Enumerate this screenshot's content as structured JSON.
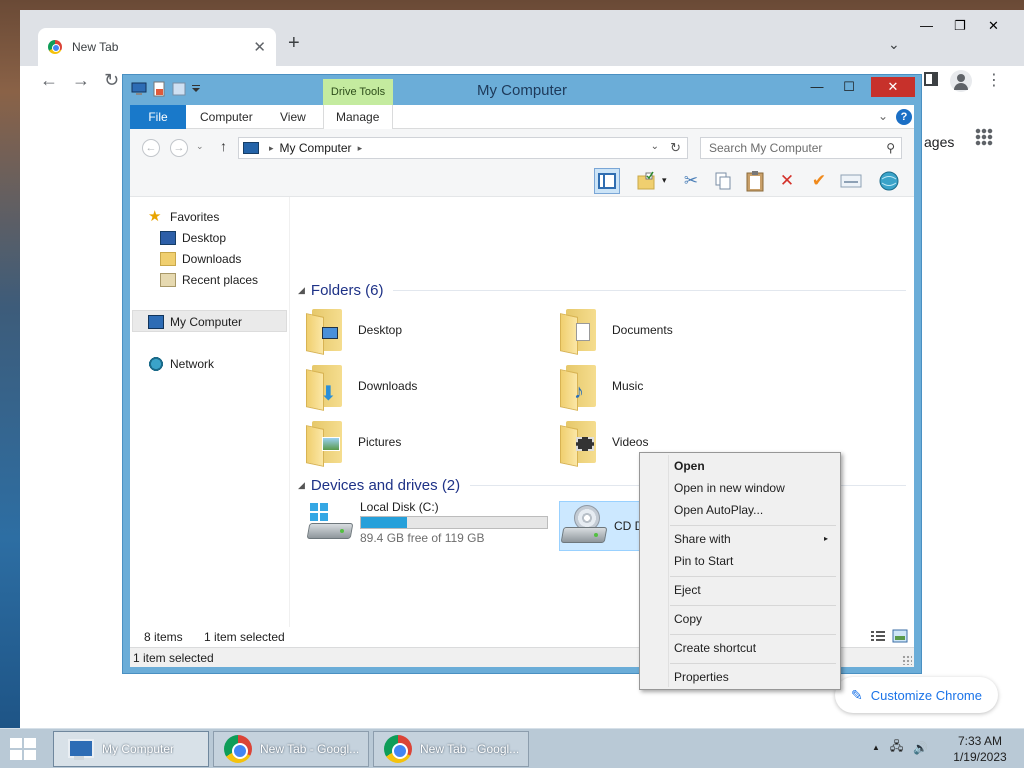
{
  "chrome": {
    "tab_title": "New Tab",
    "tab_close": "✕",
    "new_tab": "+",
    "tab_search": "⌄",
    "min": "—",
    "max": "❐",
    "close": "✕",
    "back": "←",
    "forward": "→",
    "reload": "↻",
    "menu": "⋮",
    "images_partial": "ages",
    "customize_label": "Customize Chrome",
    "pencil": "✎"
  },
  "explorer": {
    "title": "My Computer",
    "drive_tools": "Drive Tools",
    "min": "—",
    "max": "☐",
    "close": "✕",
    "ribbon_tabs": [
      "File",
      "Computer",
      "View",
      "Manage"
    ],
    "ribbon_expand": "⌄",
    "help": "?",
    "nav_back": "←",
    "nav_forward": "→",
    "nav_recent": "⌄",
    "nav_up": "↑",
    "address_sep": "▸",
    "address_location": "My Computer",
    "address_dropdown": "⌄",
    "address_refresh": "↻",
    "search_placeholder": "Search My Computer",
    "search_icon": "⚲",
    "nav_pane": {
      "favorites": "Favorites",
      "desktop": "Desktop",
      "downloads": "Downloads",
      "recent": "Recent places",
      "mycomputer": "My Computer",
      "network": "Network"
    },
    "folders_header": "Folders (6)",
    "folders": [
      "Desktop",
      "Documents",
      "Downloads",
      "Music",
      "Pictures",
      "Videos"
    ],
    "devices_header": "Devices and drives (2)",
    "drive_c": {
      "name": "Local Disk (C:)",
      "free": "89.4 GB free of 119 GB",
      "used_fraction": 0.249
    },
    "drive_d": {
      "name": "CD Drive (D:)"
    },
    "status_items": "8 items",
    "status_selected": "1 item selected",
    "status_bottom": "1 item selected"
  },
  "context_menu": {
    "open": "Open",
    "open_new_window": "Open in new window",
    "open_autoplay": "Open AutoPlay...",
    "share_with": "Share with",
    "submenu_arrow": "▸",
    "pin_to_start": "Pin to Start",
    "eject": "Eject",
    "copy": "Copy",
    "create_shortcut": "Create shortcut",
    "properties": "Properties"
  },
  "taskbar": {
    "buttons": [
      "My Computer",
      "New Tab - Googl...",
      "New Tab - Googl..."
    ],
    "tray_up": "▲",
    "tray_network": "🖧",
    "tray_volume": "🔊",
    "time": "7:33 AM",
    "date": "1/19/2023"
  },
  "colors": {
    "explorer_frame": "#6badd8",
    "file_tab": "#1979ca",
    "drive_tools": "#c4eb9f",
    "close_red": "#c7312b",
    "selection": "#cce8ff",
    "drive_bar": "#26a0da"
  }
}
